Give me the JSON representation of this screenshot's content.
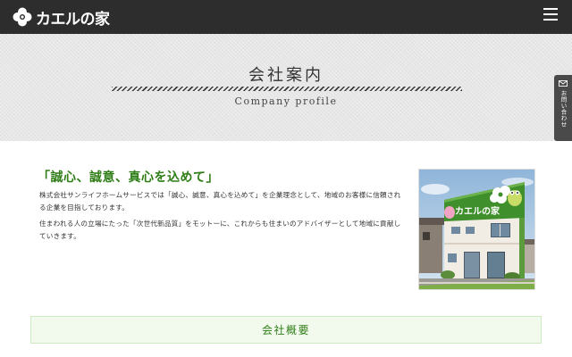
{
  "header": {
    "logo_text": "カエルの家",
    "logo_icon": "clover-icon",
    "menu_icon": "hamburger-menu-icon"
  },
  "hero": {
    "title": "会社案内",
    "subtitle": "Company profile"
  },
  "side_tab": {
    "label": "お問い合わせ",
    "icon": "mail-icon"
  },
  "intro": {
    "catchphrase": "「誠心、誠意、真心を込めて」",
    "paragraphs": [
      "株式会社サンライフホームサービスでは「誠心、誠意、真心を込めて」を企業理念として、地域のお客様に信頼される企業を目指しております。",
      "住まわれる人の立場にたった「次世代新品質」をモットーに、これからも住まいのアドバイザーとして地域に貢献していきます。"
    ],
    "photo_sign_text": "カエルの家"
  },
  "section": {
    "title": "会社概要"
  },
  "colors": {
    "header_bg": "#2d2d2d",
    "accent_green": "#2e7d16",
    "hero_bg": "#e6e6e6",
    "side_tab_bg": "#4a4a4a"
  }
}
